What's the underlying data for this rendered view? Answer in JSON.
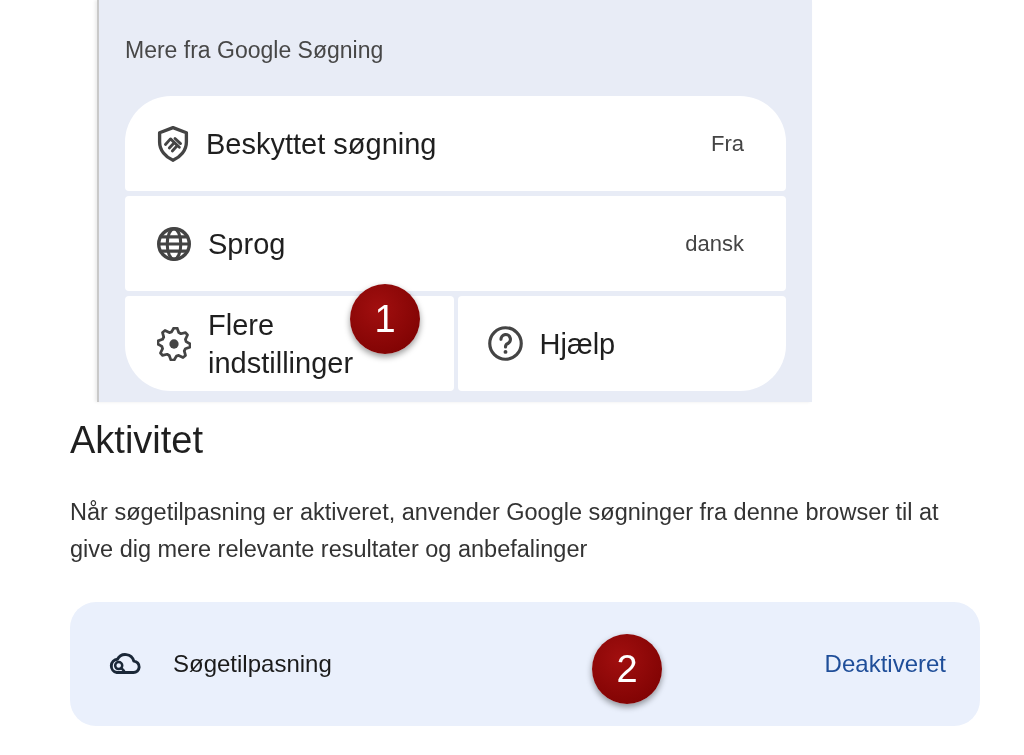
{
  "panel": {
    "heading": "Mere fra Google Søgning",
    "settings": [
      {
        "label": "Beskyttet søgning",
        "value": "Fra"
      },
      {
        "label": "Sprog",
        "value": "dansk"
      }
    ],
    "links": [
      {
        "label": "Flere indstillinger"
      },
      {
        "label": "Hjælp"
      }
    ]
  },
  "activity": {
    "title": "Aktivitet",
    "description": "Når søgetilpasning er aktiveret, anvender Google søgninger fra denne browser til at give dig mere relevante resultater og anbefalinger",
    "setting": {
      "label": "Søgetilpasning",
      "value": "Deaktiveret"
    }
  },
  "markers": [
    {
      "label": "1"
    },
    {
      "label": "2"
    }
  ]
}
